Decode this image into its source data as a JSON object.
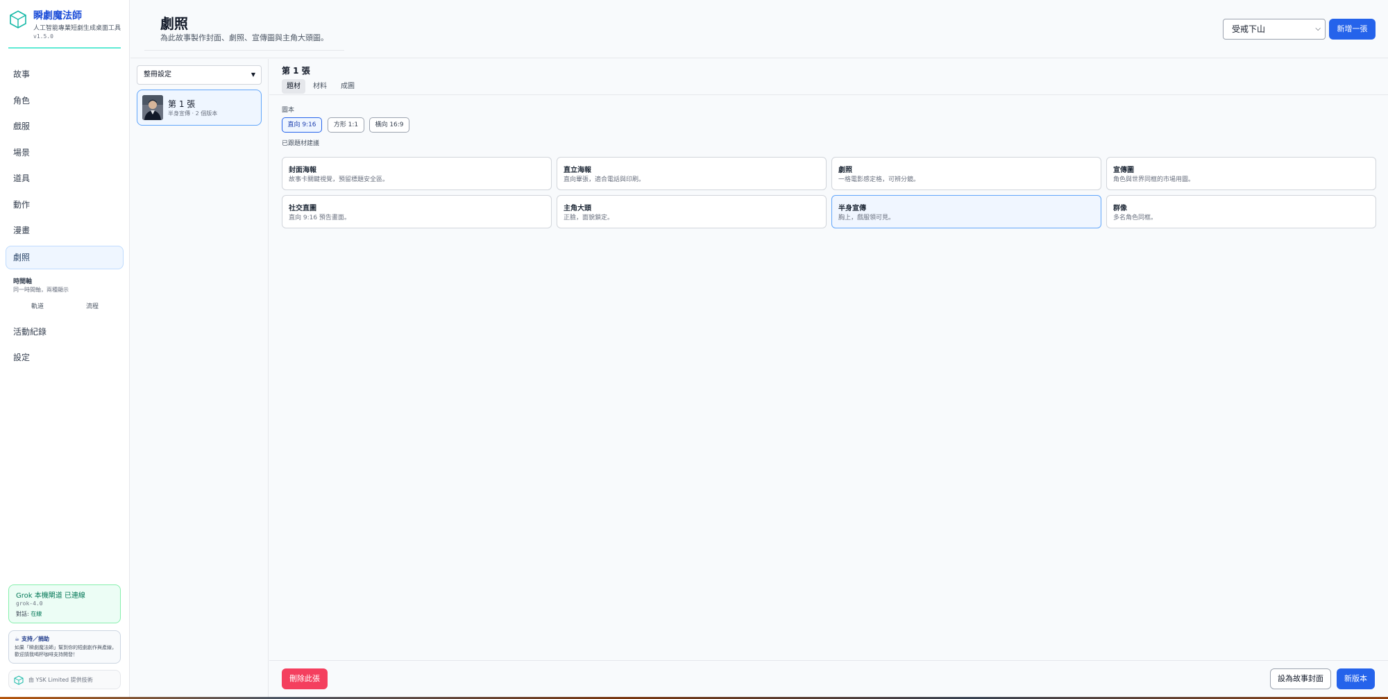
{
  "app": {
    "name": "瞬劇魔法師",
    "subtitle": "人工智能專業短劇生成桌面工具",
    "version": "v1.5.0"
  },
  "sidebar": {
    "items": [
      {
        "label": "故事"
      },
      {
        "label": "角色"
      },
      {
        "label": "戲服"
      },
      {
        "label": "場景"
      },
      {
        "label": "道具"
      },
      {
        "label": "動作"
      },
      {
        "label": "漫畫"
      },
      {
        "label": "劇照",
        "active": true
      }
    ],
    "timeline": {
      "title": "時間軸",
      "subtitle": "同一時間軸，兩種顯示",
      "links": [
        "軌道",
        "流程"
      ]
    },
    "bottom_items": [
      {
        "label": "活動紀錄"
      },
      {
        "label": "設定"
      }
    ]
  },
  "status": {
    "title": "Grok 本機閘道 已連線",
    "model": "grok-4.0",
    "session_label": "對話",
    "session_value": "在線"
  },
  "support": {
    "title": "☕ 支持／捐助",
    "text": "如果「瞬劇魔法師」幫到你的短劇創作與產線，歡迎請我喝杯咖啡支持開發！"
  },
  "credit": "由 YSK Limited 提供技術",
  "header": {
    "title": "劇照",
    "subtitle": "為此故事製作封面、劇照、宣傳圖與主角大頭圖。",
    "story_select": "受戒下山",
    "new_button": "新增一張"
  },
  "list": {
    "filter": "整冊設定",
    "cards": [
      {
        "title": "第 1 張",
        "subtitle": "半身宣傳 · 2 個版本"
      }
    ]
  },
  "main": {
    "title": "第 1 張",
    "tabs": [
      {
        "label": "題材",
        "active": true
      },
      {
        "label": "材料"
      },
      {
        "label": "成圖"
      }
    ],
    "ratio_label": "圖本",
    "ratios": [
      {
        "label": "直向 9:16",
        "active": true
      },
      {
        "label": "方形 1:1"
      },
      {
        "label": "橫向 16:9"
      }
    ],
    "template_hint": "已跟題材建議",
    "templates": [
      {
        "title": "封面海報",
        "desc": "故事卡關鍵視覺，預留標題安全區。"
      },
      {
        "title": "直立海報",
        "desc": "直向畢張，適合電話與印刷。"
      },
      {
        "title": "劇照",
        "desc": "一格電影感定格，可辨分鏡。"
      },
      {
        "title": "宣傳圖",
        "desc": "角色與世界同框的市場用圖。"
      },
      {
        "title": "社交直圖",
        "desc": "直向 9:16 預告畫面。"
      },
      {
        "title": "主角大頭",
        "desc": "正臉，面貌鎖定。"
      },
      {
        "title": "半身宣傳",
        "desc": "胸上，戲服領可見。",
        "active": true
      },
      {
        "title": "群像",
        "desc": "多名角色同框。"
      }
    ],
    "footer": {
      "delete": "刪除此張",
      "set_cover": "設為故事封面",
      "new_version": "新版本"
    }
  },
  "colors": {
    "accent": "#2563eb",
    "danger": "#f43f5e",
    "success": "#047857"
  }
}
